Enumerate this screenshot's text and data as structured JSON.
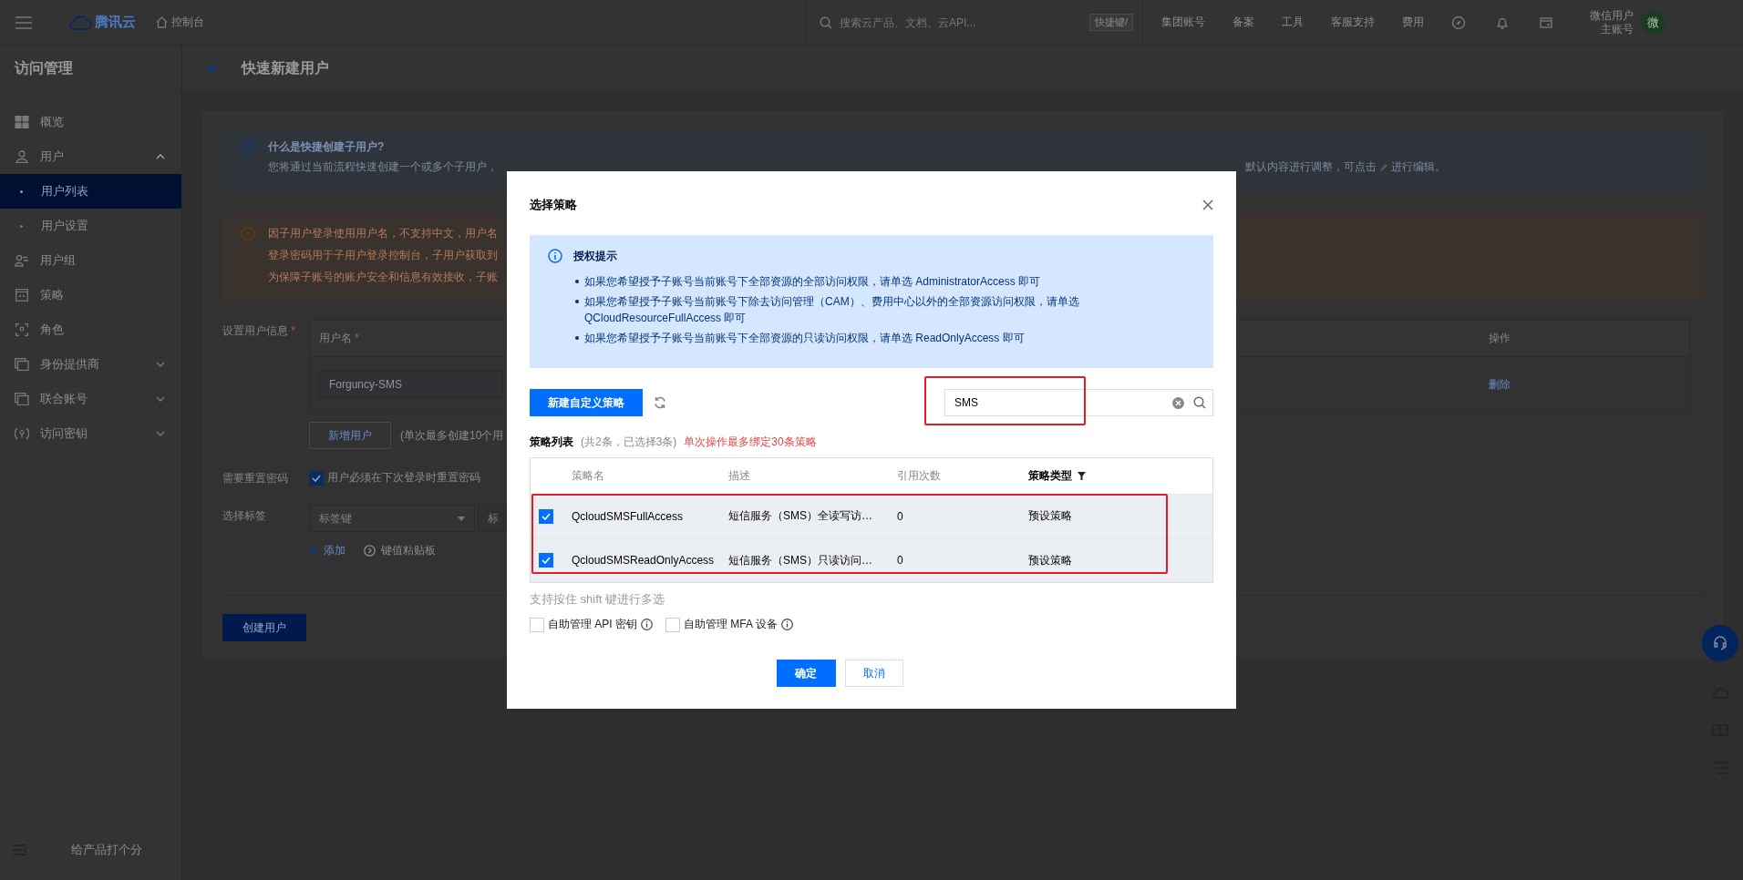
{
  "topbar": {
    "brand": "腾讯云",
    "console": "控制台",
    "search_placeholder": "搜索云产品、文档、云API...",
    "shortcut": "快捷键/",
    "links": [
      "集团账号",
      "备案",
      "工具",
      "客服支持",
      "费用"
    ],
    "user_name": "微信用户",
    "user_role": "主账号",
    "avatar": "微"
  },
  "sidebar": {
    "title": "访问管理",
    "items": [
      {
        "label": "概览",
        "kind": "link",
        "selected": false
      },
      {
        "label": "用户",
        "kind": "group",
        "expanded": true,
        "children": [
          {
            "label": "用户列表",
            "selected": true
          },
          {
            "label": "用户设置",
            "selected": false
          }
        ]
      },
      {
        "label": "用户组",
        "kind": "link",
        "selected": false
      },
      {
        "label": "策略",
        "kind": "link",
        "selected": false
      },
      {
        "label": "角色",
        "kind": "link",
        "selected": false
      },
      {
        "label": "身份提供商",
        "kind": "group",
        "expanded": false
      },
      {
        "label": "联合账号",
        "kind": "group",
        "expanded": false
      },
      {
        "label": "访问密钥",
        "kind": "group",
        "expanded": false
      }
    ],
    "feedback": "给产品打个分"
  },
  "page": {
    "title": "快速新建用户",
    "info": {
      "title": "什么是快捷创建子用户?",
      "text_left": "您将通过当前流程快速创建一个或多个子用户，",
      "text_right": "默认内容进行调整，可点击",
      "text_end": "进行编辑。"
    },
    "warnings": [
      "因子用户登录使用用户名，不支持中文，用户名",
      "登录密码用于子用户登录控制台，子用户获取到",
      "为保障子账号的账户安全和信息有效接收，子账"
    ],
    "form": {
      "user_info_label": "设置用户信息",
      "required_mark": "*",
      "username_header": "用户名",
      "action_header": "操作",
      "rows": [
        {
          "username": "Forguncy-SMS",
          "action": "删除"
        }
      ],
      "add_button": "新增用户",
      "add_note": "(单次最多创建10个用",
      "reset_label": "需要重置密码",
      "reset_checked": true,
      "reset_text": "用户必须在下次登录时重置密码",
      "tags_label": "选择标签",
      "tag_key_placeholder": "标签键",
      "tag_value_placeholder": "标",
      "add_tag": "添加",
      "paste": "键值粘贴板",
      "create_button": "创建用户"
    }
  },
  "modal": {
    "title": "选择策略",
    "tip_title": "授权提示",
    "tips": [
      "如果您希望授予子账号当前账号下全部资源的全部访问权限，请单选 AdministratorAccess 即可",
      "如果您希望授予子账号当前账号下除去访问管理（CAM）、费用中心以外的全部资源访问权限，请单选 QCloudResourceFullAccess 即可",
      "如果您希望授予子账号当前账号下全部资源的只读访问权限，请单选 ReadOnlyAccess 即可"
    ],
    "create_button": "新建自定义策略",
    "search_value": "SMS",
    "list_label": "策略列表",
    "list_count": "(共2条，已选择3条)",
    "list_limit": "单次操作最多绑定30条策略",
    "columns": [
      {
        "label": "策略名",
        "kind": "plain"
      },
      {
        "label": "描述",
        "kind": "plain"
      },
      {
        "label": "引用次数",
        "kind": "plain"
      },
      {
        "label": "策略类型",
        "kind": "filter"
      }
    ],
    "rows": [
      {
        "name": "QcloudSMSFullAccess",
        "description": "短信服务（SMS）全读写访…",
        "uses": "0",
        "type": "预设策略",
        "checked": true
      },
      {
        "name": "QcloudSMSReadOnlyAccess",
        "description": "短信服务（SMS）只读访问…",
        "uses": "0",
        "type": "预设策略",
        "checked": true
      }
    ],
    "hint": "支持按住 shift 键进行多选",
    "options": [
      {
        "label": "自助管理 API 密钥",
        "checked": false
      },
      {
        "label": "自助管理 MFA 设备",
        "checked": false
      }
    ],
    "ok": "确定",
    "cancel": "取消"
  }
}
